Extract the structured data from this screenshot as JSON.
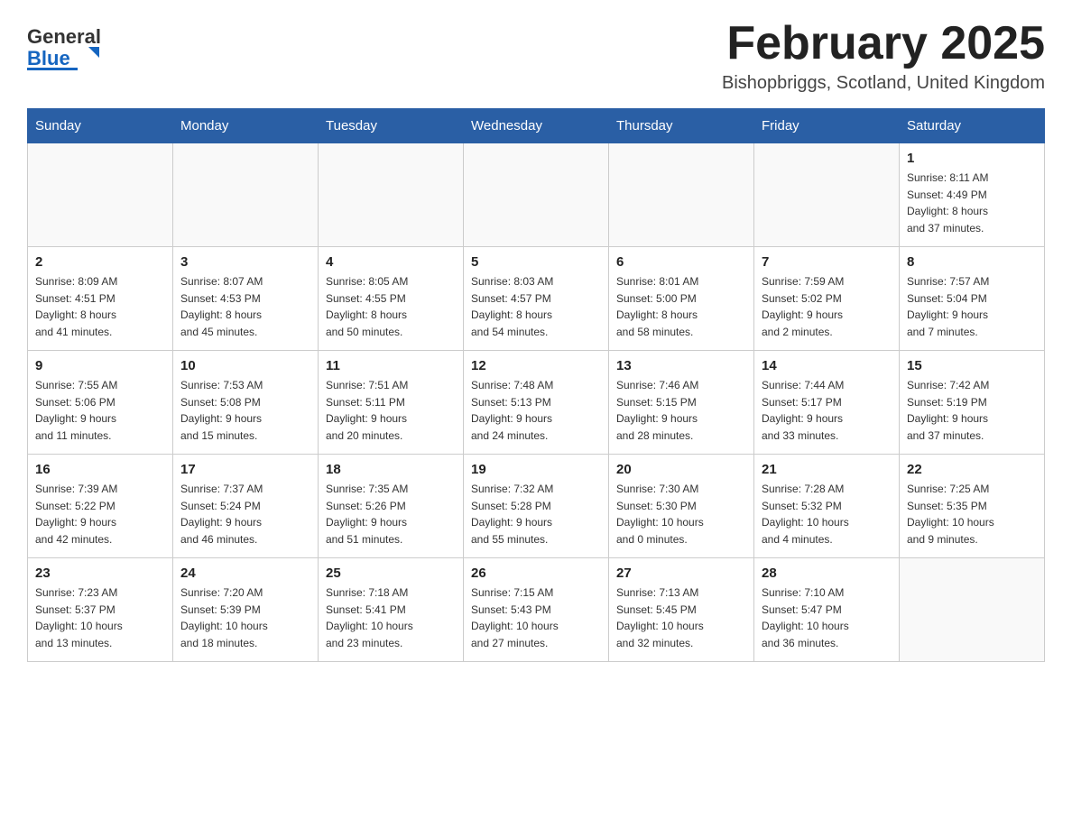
{
  "header": {
    "logo_text_general": "General",
    "logo_text_blue": "Blue",
    "month_title": "February 2025",
    "location": "Bishopbriggs, Scotland, United Kingdom"
  },
  "weekdays": [
    "Sunday",
    "Monday",
    "Tuesday",
    "Wednesday",
    "Thursday",
    "Friday",
    "Saturday"
  ],
  "weeks": [
    [
      {
        "day": "",
        "info": ""
      },
      {
        "day": "",
        "info": ""
      },
      {
        "day": "",
        "info": ""
      },
      {
        "day": "",
        "info": ""
      },
      {
        "day": "",
        "info": ""
      },
      {
        "day": "",
        "info": ""
      },
      {
        "day": "1",
        "info": "Sunrise: 8:11 AM\nSunset: 4:49 PM\nDaylight: 8 hours\nand 37 minutes."
      }
    ],
    [
      {
        "day": "2",
        "info": "Sunrise: 8:09 AM\nSunset: 4:51 PM\nDaylight: 8 hours\nand 41 minutes."
      },
      {
        "day": "3",
        "info": "Sunrise: 8:07 AM\nSunset: 4:53 PM\nDaylight: 8 hours\nand 45 minutes."
      },
      {
        "day": "4",
        "info": "Sunrise: 8:05 AM\nSunset: 4:55 PM\nDaylight: 8 hours\nand 50 minutes."
      },
      {
        "day": "5",
        "info": "Sunrise: 8:03 AM\nSunset: 4:57 PM\nDaylight: 8 hours\nand 54 minutes."
      },
      {
        "day": "6",
        "info": "Sunrise: 8:01 AM\nSunset: 5:00 PM\nDaylight: 8 hours\nand 58 minutes."
      },
      {
        "day": "7",
        "info": "Sunrise: 7:59 AM\nSunset: 5:02 PM\nDaylight: 9 hours\nand 2 minutes."
      },
      {
        "day": "8",
        "info": "Sunrise: 7:57 AM\nSunset: 5:04 PM\nDaylight: 9 hours\nand 7 minutes."
      }
    ],
    [
      {
        "day": "9",
        "info": "Sunrise: 7:55 AM\nSunset: 5:06 PM\nDaylight: 9 hours\nand 11 minutes."
      },
      {
        "day": "10",
        "info": "Sunrise: 7:53 AM\nSunset: 5:08 PM\nDaylight: 9 hours\nand 15 minutes."
      },
      {
        "day": "11",
        "info": "Sunrise: 7:51 AM\nSunset: 5:11 PM\nDaylight: 9 hours\nand 20 minutes."
      },
      {
        "day": "12",
        "info": "Sunrise: 7:48 AM\nSunset: 5:13 PM\nDaylight: 9 hours\nand 24 minutes."
      },
      {
        "day": "13",
        "info": "Sunrise: 7:46 AM\nSunset: 5:15 PM\nDaylight: 9 hours\nand 28 minutes."
      },
      {
        "day": "14",
        "info": "Sunrise: 7:44 AM\nSunset: 5:17 PM\nDaylight: 9 hours\nand 33 minutes."
      },
      {
        "day": "15",
        "info": "Sunrise: 7:42 AM\nSunset: 5:19 PM\nDaylight: 9 hours\nand 37 minutes."
      }
    ],
    [
      {
        "day": "16",
        "info": "Sunrise: 7:39 AM\nSunset: 5:22 PM\nDaylight: 9 hours\nand 42 minutes."
      },
      {
        "day": "17",
        "info": "Sunrise: 7:37 AM\nSunset: 5:24 PM\nDaylight: 9 hours\nand 46 minutes."
      },
      {
        "day": "18",
        "info": "Sunrise: 7:35 AM\nSunset: 5:26 PM\nDaylight: 9 hours\nand 51 minutes."
      },
      {
        "day": "19",
        "info": "Sunrise: 7:32 AM\nSunset: 5:28 PM\nDaylight: 9 hours\nand 55 minutes."
      },
      {
        "day": "20",
        "info": "Sunrise: 7:30 AM\nSunset: 5:30 PM\nDaylight: 10 hours\nand 0 minutes."
      },
      {
        "day": "21",
        "info": "Sunrise: 7:28 AM\nSunset: 5:32 PM\nDaylight: 10 hours\nand 4 minutes."
      },
      {
        "day": "22",
        "info": "Sunrise: 7:25 AM\nSunset: 5:35 PM\nDaylight: 10 hours\nand 9 minutes."
      }
    ],
    [
      {
        "day": "23",
        "info": "Sunrise: 7:23 AM\nSunset: 5:37 PM\nDaylight: 10 hours\nand 13 minutes."
      },
      {
        "day": "24",
        "info": "Sunrise: 7:20 AM\nSunset: 5:39 PM\nDaylight: 10 hours\nand 18 minutes."
      },
      {
        "day": "25",
        "info": "Sunrise: 7:18 AM\nSunset: 5:41 PM\nDaylight: 10 hours\nand 23 minutes."
      },
      {
        "day": "26",
        "info": "Sunrise: 7:15 AM\nSunset: 5:43 PM\nDaylight: 10 hours\nand 27 minutes."
      },
      {
        "day": "27",
        "info": "Sunrise: 7:13 AM\nSunset: 5:45 PM\nDaylight: 10 hours\nand 32 minutes."
      },
      {
        "day": "28",
        "info": "Sunrise: 7:10 AM\nSunset: 5:47 PM\nDaylight: 10 hours\nand 36 minutes."
      },
      {
        "day": "",
        "info": ""
      }
    ]
  ]
}
